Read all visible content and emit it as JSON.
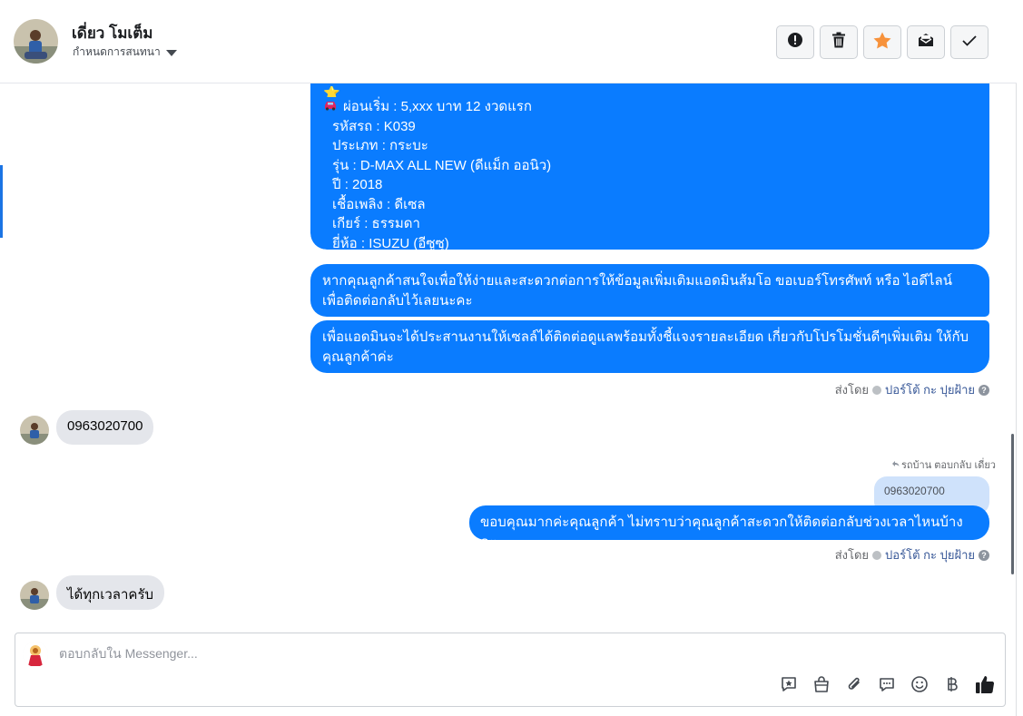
{
  "header": {
    "contact_name": "เดี่ยว โมเต็ม",
    "assign_label": "กำหนดการสนทนา",
    "actions": [
      "spam",
      "delete",
      "star",
      "mark-unread",
      "done"
    ]
  },
  "messages": {
    "listing": {
      "emoji": "⭐",
      "line1": "ผ่อนเริ่ม : 5,xxx บาท 12 งวดแรก",
      "line2": "รหัสรถ : K039",
      "line3": "ประเภท : กระบะ",
      "line4": "รุ่น : D-MAX ALL NEW (ดีแม็ก ออนิว)",
      "line5": "ปี : 2018",
      "line6": "เชื้อเพลิง : ดีเซล",
      "line7": "เกียร์ : ธรรมดา",
      "line8": "ยี่ห้อ : ISUZU (อีซูซุ)"
    },
    "out1": "หากคุณลูกค้าสนใจเพื่อให้ง่ายและสะดวกต่อการให้ข้อมูลเพิ่มเติมแอดมินส้มโอ ขอเบอร์โทรศัพท์ หรือ ไอดีไลน์ เพื่อติดต่อกลับไว้เลยนะคะ",
    "out2": "เพื่อแอดมินจะได้ประสานงานให้เซลล์ได้ติดต่อดูแลพร้อมทั้งชี้แจงรายละเอียด เกี่ยวกับโปรโมชั่นดีๆเพิ่มเติม ให้กับคุณลูกค้าค่ะ",
    "sent_by_prefix": "ส่งโดย",
    "sent_by_agent": "ปอร์โต้ กะ ปุยฝ้าย",
    "in1": "0963020700",
    "reply_note": "รถบ้าน ตอบกลับ เดี่ยว",
    "quoted": "0963020700",
    "out3": "ขอบคุณมากค่ะคุณลูกค้า ไม่ทราบว่าคุณลูกค้าสะดวกให้ติดต่อกลับช่วงเวลาไหนบ้างคะ",
    "in2": "ได้ทุกเวลาครับ"
  },
  "composer": {
    "placeholder": "ตอบกลับใน Messenger..."
  },
  "colors": {
    "accent": "#0a7cff",
    "incoming": "#e4e6eb",
    "star": "#f7923b"
  }
}
